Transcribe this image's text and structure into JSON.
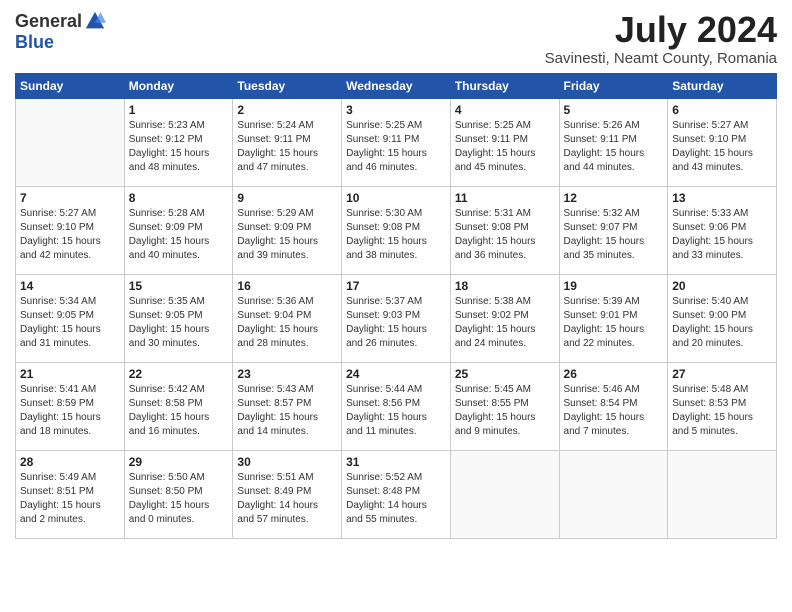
{
  "header": {
    "logo_general": "General",
    "logo_blue": "Blue",
    "month_title": "July 2024",
    "location": "Savinesti, Neamt County, Romania"
  },
  "days_of_week": [
    "Sunday",
    "Monday",
    "Tuesday",
    "Wednesday",
    "Thursday",
    "Friday",
    "Saturday"
  ],
  "weeks": [
    [
      {
        "day": "",
        "content": ""
      },
      {
        "day": "1",
        "content": "Sunrise: 5:23 AM\nSunset: 9:12 PM\nDaylight: 15 hours\nand 48 minutes."
      },
      {
        "day": "2",
        "content": "Sunrise: 5:24 AM\nSunset: 9:11 PM\nDaylight: 15 hours\nand 47 minutes."
      },
      {
        "day": "3",
        "content": "Sunrise: 5:25 AM\nSunset: 9:11 PM\nDaylight: 15 hours\nand 46 minutes."
      },
      {
        "day": "4",
        "content": "Sunrise: 5:25 AM\nSunset: 9:11 PM\nDaylight: 15 hours\nand 45 minutes."
      },
      {
        "day": "5",
        "content": "Sunrise: 5:26 AM\nSunset: 9:11 PM\nDaylight: 15 hours\nand 44 minutes."
      },
      {
        "day": "6",
        "content": "Sunrise: 5:27 AM\nSunset: 9:10 PM\nDaylight: 15 hours\nand 43 minutes."
      }
    ],
    [
      {
        "day": "7",
        "content": "Sunrise: 5:27 AM\nSunset: 9:10 PM\nDaylight: 15 hours\nand 42 minutes."
      },
      {
        "day": "8",
        "content": "Sunrise: 5:28 AM\nSunset: 9:09 PM\nDaylight: 15 hours\nand 40 minutes."
      },
      {
        "day": "9",
        "content": "Sunrise: 5:29 AM\nSunset: 9:09 PM\nDaylight: 15 hours\nand 39 minutes."
      },
      {
        "day": "10",
        "content": "Sunrise: 5:30 AM\nSunset: 9:08 PM\nDaylight: 15 hours\nand 38 minutes."
      },
      {
        "day": "11",
        "content": "Sunrise: 5:31 AM\nSunset: 9:08 PM\nDaylight: 15 hours\nand 36 minutes."
      },
      {
        "day": "12",
        "content": "Sunrise: 5:32 AM\nSunset: 9:07 PM\nDaylight: 15 hours\nand 35 minutes."
      },
      {
        "day": "13",
        "content": "Sunrise: 5:33 AM\nSunset: 9:06 PM\nDaylight: 15 hours\nand 33 minutes."
      }
    ],
    [
      {
        "day": "14",
        "content": "Sunrise: 5:34 AM\nSunset: 9:05 PM\nDaylight: 15 hours\nand 31 minutes."
      },
      {
        "day": "15",
        "content": "Sunrise: 5:35 AM\nSunset: 9:05 PM\nDaylight: 15 hours\nand 30 minutes."
      },
      {
        "day": "16",
        "content": "Sunrise: 5:36 AM\nSunset: 9:04 PM\nDaylight: 15 hours\nand 28 minutes."
      },
      {
        "day": "17",
        "content": "Sunrise: 5:37 AM\nSunset: 9:03 PM\nDaylight: 15 hours\nand 26 minutes."
      },
      {
        "day": "18",
        "content": "Sunrise: 5:38 AM\nSunset: 9:02 PM\nDaylight: 15 hours\nand 24 minutes."
      },
      {
        "day": "19",
        "content": "Sunrise: 5:39 AM\nSunset: 9:01 PM\nDaylight: 15 hours\nand 22 minutes."
      },
      {
        "day": "20",
        "content": "Sunrise: 5:40 AM\nSunset: 9:00 PM\nDaylight: 15 hours\nand 20 minutes."
      }
    ],
    [
      {
        "day": "21",
        "content": "Sunrise: 5:41 AM\nSunset: 8:59 PM\nDaylight: 15 hours\nand 18 minutes."
      },
      {
        "day": "22",
        "content": "Sunrise: 5:42 AM\nSunset: 8:58 PM\nDaylight: 15 hours\nand 16 minutes."
      },
      {
        "day": "23",
        "content": "Sunrise: 5:43 AM\nSunset: 8:57 PM\nDaylight: 15 hours\nand 14 minutes."
      },
      {
        "day": "24",
        "content": "Sunrise: 5:44 AM\nSunset: 8:56 PM\nDaylight: 15 hours\nand 11 minutes."
      },
      {
        "day": "25",
        "content": "Sunrise: 5:45 AM\nSunset: 8:55 PM\nDaylight: 15 hours\nand 9 minutes."
      },
      {
        "day": "26",
        "content": "Sunrise: 5:46 AM\nSunset: 8:54 PM\nDaylight: 15 hours\nand 7 minutes."
      },
      {
        "day": "27",
        "content": "Sunrise: 5:48 AM\nSunset: 8:53 PM\nDaylight: 15 hours\nand 5 minutes."
      }
    ],
    [
      {
        "day": "28",
        "content": "Sunrise: 5:49 AM\nSunset: 8:51 PM\nDaylight: 15 hours\nand 2 minutes."
      },
      {
        "day": "29",
        "content": "Sunrise: 5:50 AM\nSunset: 8:50 PM\nDaylight: 15 hours\nand 0 minutes."
      },
      {
        "day": "30",
        "content": "Sunrise: 5:51 AM\nSunset: 8:49 PM\nDaylight: 14 hours\nand 57 minutes."
      },
      {
        "day": "31",
        "content": "Sunrise: 5:52 AM\nSunset: 8:48 PM\nDaylight: 14 hours\nand 55 minutes."
      },
      {
        "day": "",
        "content": ""
      },
      {
        "day": "",
        "content": ""
      },
      {
        "day": "",
        "content": ""
      }
    ]
  ]
}
